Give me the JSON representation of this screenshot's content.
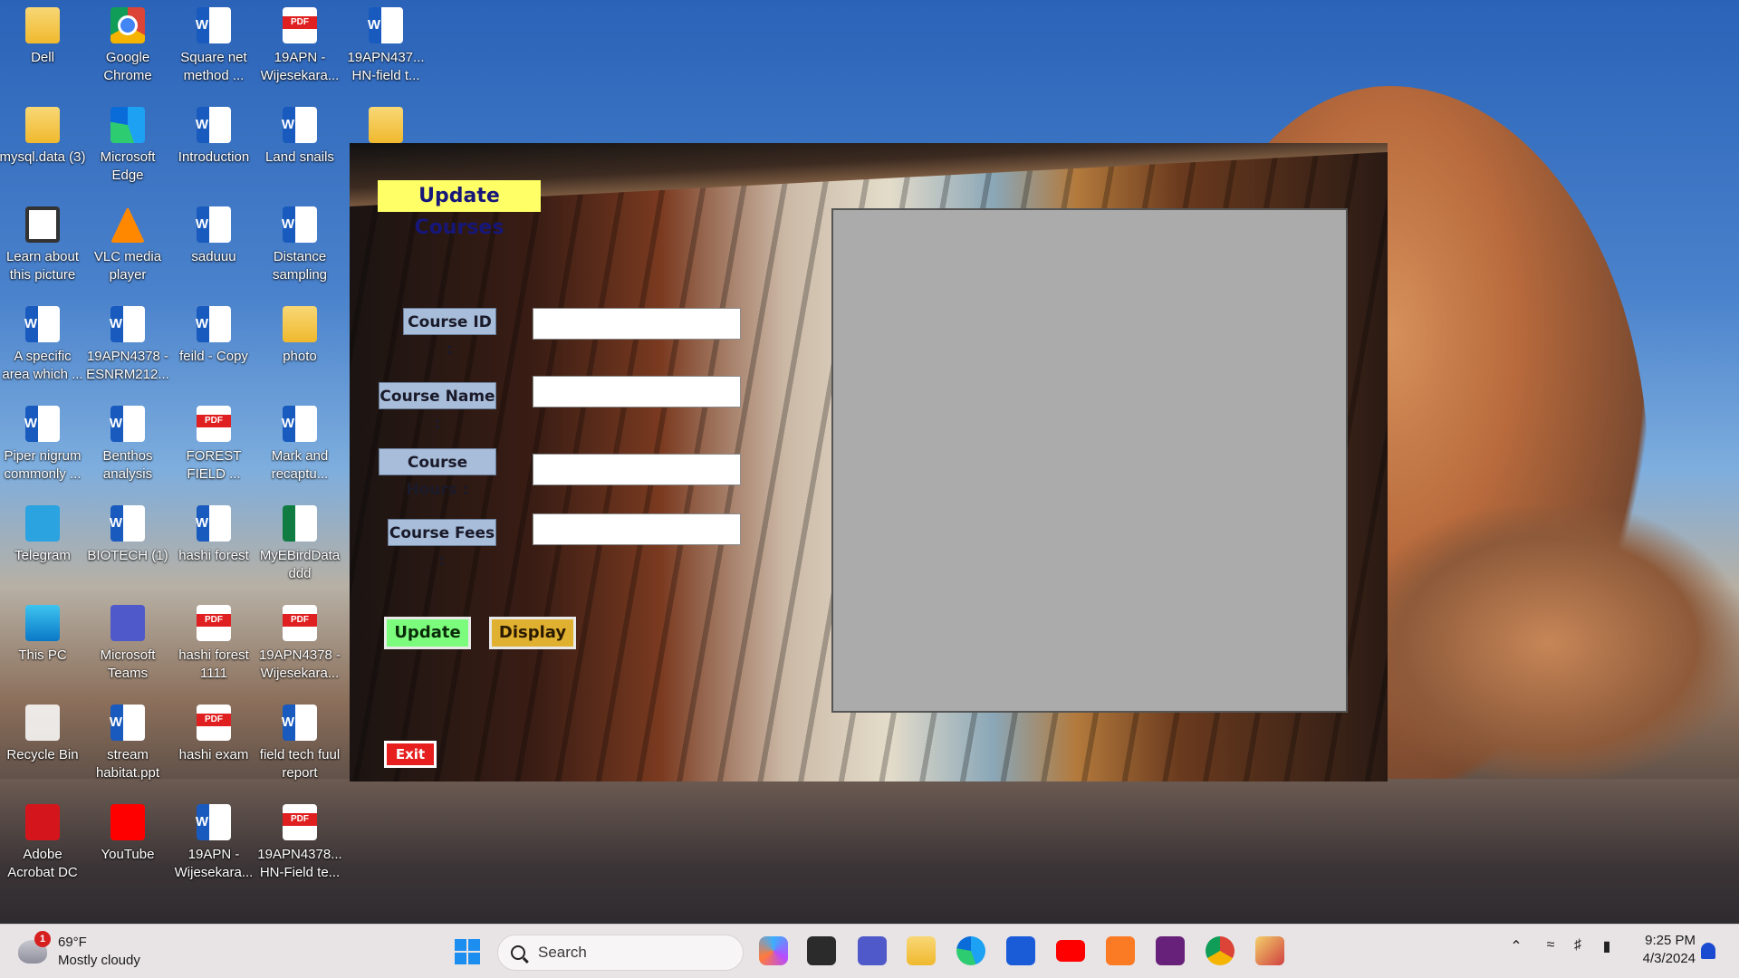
{
  "desktop": {
    "icons": [
      {
        "label": "Dell",
        "icon": "folder-icon"
      },
      {
        "label": "Google Chrome",
        "icon": "chrome-icon"
      },
      {
        "label": "Square net method ...",
        "icon": "word-doc-icon"
      },
      {
        "label": "19APN -Wijesekara...",
        "icon": "pdf-icon"
      },
      {
        "label": "19APN437... HN-field t...",
        "icon": "word-doc-icon"
      },
      {
        "label": "mysql.data (3)",
        "icon": "folder-icon"
      },
      {
        "label": "Microsoft Edge",
        "icon": "edge-icon"
      },
      {
        "label": "Introduction",
        "icon": "word-doc-icon"
      },
      {
        "label": "Land snails",
        "icon": "word-doc-icon"
      },
      {
        "label": "",
        "icon": "folder-icon"
      },
      {
        "label": "Learn about this picture",
        "icon": "camera-icon"
      },
      {
        "label": "VLC media player",
        "icon": "vlc-icon"
      },
      {
        "label": "saduuu",
        "icon": "word-doc-icon"
      },
      {
        "label": "Distance sampling",
        "icon": "word-doc-icon"
      },
      {
        "label": "A specific area which ...",
        "icon": "word-doc-icon"
      },
      {
        "label": "19APN4378 -ESNRM212...",
        "icon": "word-doc-icon"
      },
      {
        "label": "feild - Copy",
        "icon": "word-doc-icon"
      },
      {
        "label": "photo",
        "icon": "folder-icon"
      },
      {
        "label": "Piper nigrum commonly ...",
        "icon": "word-doc-icon"
      },
      {
        "label": "Benthos analysis",
        "icon": "word-doc-icon"
      },
      {
        "label": "FOREST FIELD ...",
        "icon": "pdf-icon"
      },
      {
        "label": "Mark and recaptu...",
        "icon": "word-doc-icon"
      },
      {
        "label": "Telegram",
        "icon": "telegram-icon"
      },
      {
        "label": "BIOTECH (1)",
        "icon": "word-doc-icon"
      },
      {
        "label": "hashi forest",
        "icon": "word-doc-icon"
      },
      {
        "label": "MyEBirdData ddd",
        "icon": "excel-icon"
      },
      {
        "label": "This PC",
        "icon": "computer-icon"
      },
      {
        "label": "Microsoft Teams",
        "icon": "teams-icon"
      },
      {
        "label": "hashi forest 1111",
        "icon": "pdf-icon"
      },
      {
        "label": "19APN4378 -Wijesekara...",
        "icon": "pdf-icon"
      },
      {
        "label": "Recycle Bin",
        "icon": "recycle-bin-icon"
      },
      {
        "label": "stream habitat.ppt",
        "icon": "word-doc-icon"
      },
      {
        "label": "hashi exam",
        "icon": "pdf-icon"
      },
      {
        "label": "field tech fuul report",
        "icon": "word-doc-icon"
      },
      {
        "label": "Adobe Acrobat DC",
        "icon": "acrobat-icon"
      },
      {
        "label": "YouTube",
        "icon": "youtube-icon"
      },
      {
        "label": "19APN -Wijesekara...",
        "icon": "word-doc-icon"
      },
      {
        "label": "19APN4378... HN-Field te...",
        "icon": "pdf-icon"
      }
    ]
  },
  "app": {
    "title": "Update Courses",
    "fields": [
      {
        "label": "Course ID :",
        "value": ""
      },
      {
        "label": "Course Name :",
        "value": ""
      },
      {
        "label": "Course Hours :",
        "value": ""
      },
      {
        "label": "Course Fees :",
        "value": ""
      }
    ],
    "buttons": {
      "update": "Update",
      "display": "Display",
      "exit": "Exit"
    },
    "colors": {
      "title_bg": "#ffff66",
      "update_bg": "#7cfc7c",
      "display_bg": "#e0b030",
      "exit_bg": "#e61e1e",
      "panel_bg": "#ababab"
    }
  },
  "taskbar": {
    "weather": {
      "temp": "69°F",
      "condition": "Mostly cloudy",
      "badge": "1"
    },
    "search_placeholder": "Search",
    "pdf_badge_text": "PDF",
    "pinned_apps": [
      "copilot-icon",
      "task-view-icon",
      "teams-icon",
      "file-explorer-icon",
      "edge-icon",
      "store-icon",
      "youtube-icon",
      "xampp-icon",
      "visual-studio-icon",
      "chrome-icon",
      "app-icon"
    ],
    "clock": {
      "time": "9:25 PM",
      "date": "4/3/2024"
    }
  }
}
